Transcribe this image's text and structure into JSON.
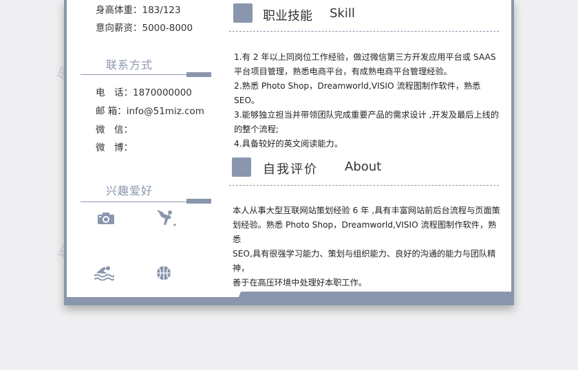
{
  "personal": {
    "height_weight": "身高体重：183/123",
    "salary": "意向薪资：5000-8000"
  },
  "contact": {
    "title": "联系方式",
    "phone": "电　话：1870000000",
    "email": "邮 箱：info@51miz.com",
    "wechat": "微　信：",
    "weibo": "微　博："
  },
  "hobbies": {
    "title": "兴趣爱好",
    "icons": [
      "camera-icon",
      "baseball-icon",
      "swimming-icon",
      "basketball-icon"
    ]
  },
  "skills": {
    "title_cn": "职业技能",
    "title_en": "Skill",
    "lines": [
      "1.有 2 年以上同岗位工作经验，做过微信第三方开发应用平台或 SAAS",
      "平台项目管理，熟悉电商平台，有成熟电商平台管理经验。",
      "2.熟悉 Photo Shop，Dreamworld,VISIO 流程图制作软件，熟悉 SEO。",
      "3.能够独立担当并带领团队完成重要产品的需求设计 ,开发及最后上线的",
      "的整个流程;",
      "4.具备较好的英文阅读能力。"
    ]
  },
  "about": {
    "title_cn": "自我评价",
    "title_en": "About",
    "lines": [
      "本人从事大型互联网站策划经验 6 年 ,具有丰富网站前后台流程与页面策",
      "划经验。熟悉 Photo Shop，Dreamworld,VISIO 流程图制作软件，熟悉",
      "SEO,具有很强学习能力、策划与组织能力、良好的沟通的能力与团队精神，",
      "善于在高压环境中处理好本职工作。"
    ]
  },
  "watermark": "觅知网",
  "colors": {
    "accent": "#8a96ad",
    "background": "#efeff1"
  }
}
